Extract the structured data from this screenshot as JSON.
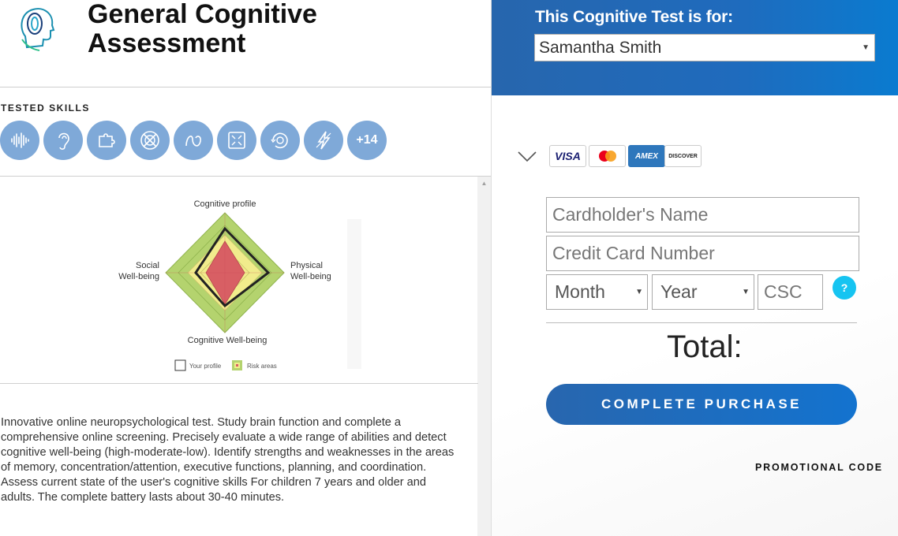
{
  "product": {
    "title_line1": "General Cognitive",
    "title_line2": "Assessment",
    "skills_label": "TESTED SKILLS",
    "skills_more": "+14",
    "skill_icons": [
      "sound-wave-icon",
      "ear-icon",
      "puzzle-icon",
      "no-target-icon",
      "path-icon",
      "focus-frame-icon",
      "rotate-icon",
      "lightning-icon"
    ],
    "description": "Innovative online neuropsychological test. Study brain function and complete a comprehensive online screening. Precisely evaluate a wide range of abilities and detect cognitive well-being (high-moderate-low). Identify strengths and weaknesses in the areas of memory, concentration/attention, executive functions, planning, and coordination. Assess current state of the user's cognitive skills For children 7 years and older and adults. The complete battery lasts about 30-40 minutes."
  },
  "profile_chart": {
    "label_top": "Cognitive profile",
    "label_left_1": "Social",
    "label_left_2": "Well-being",
    "label_right_1": "Physical",
    "label_right_2": "Well-being",
    "label_bottom": "Cognitive Well-being",
    "legend_profile": "Your profile",
    "legend_risk": "Risk areas",
    "colors": {
      "outer": "#b4d36e",
      "middle": "#f1ec8c",
      "inner": "#d85f64",
      "profile": "#222222"
    }
  },
  "checkout": {
    "header_label": "This Cognitive Test is for:",
    "selected_person": "Samantha Smith",
    "cards": [
      "VISA",
      "mastercard",
      "AMEX",
      "DISCOVER"
    ],
    "cardholder_placeholder": "Cardholder's Name",
    "card_number_placeholder": "Credit Card Number",
    "month_label": "Month",
    "year_label": "Year",
    "csc_placeholder": "CSC",
    "help_label": "?",
    "total_label": "Total:",
    "purchase_button": "COMPLETE PURCHASE",
    "promo_label": "PROMOTIONAL CODE",
    "accent": "#1f6bbd"
  }
}
